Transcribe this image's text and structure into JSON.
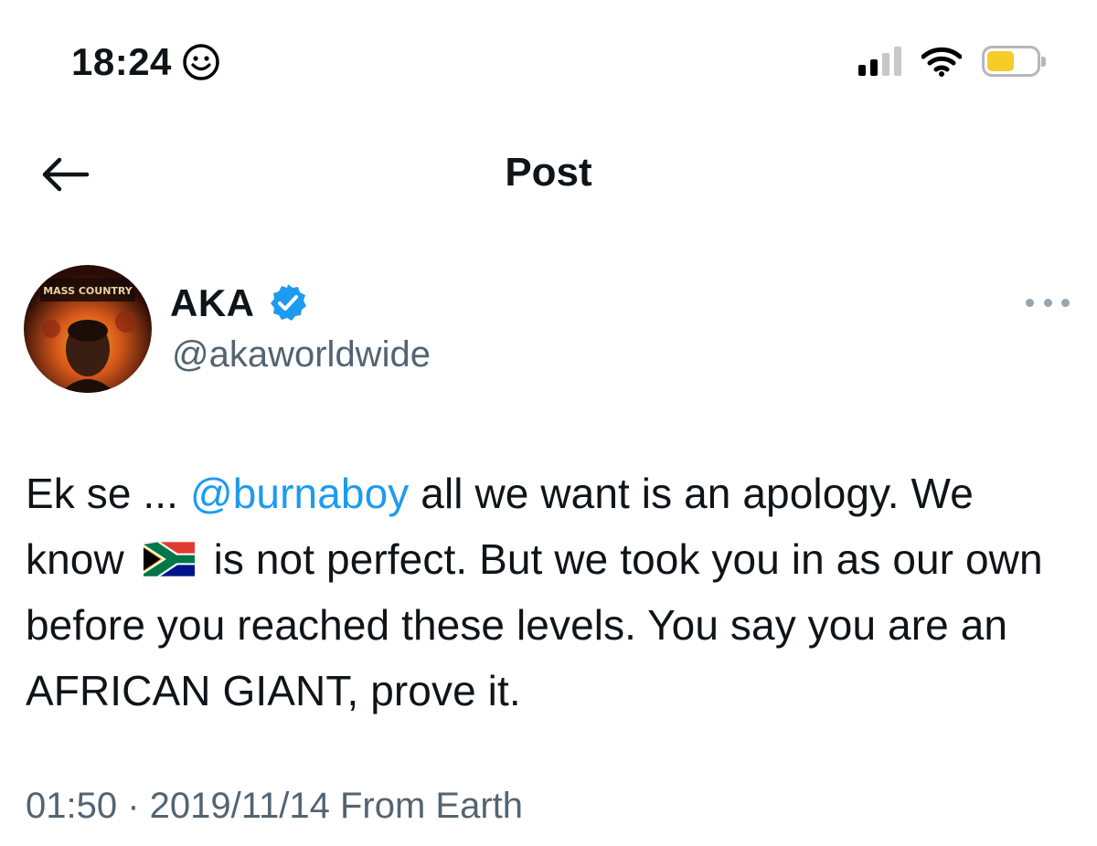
{
  "status_bar": {
    "time": "18:24",
    "smiley_icon": "smiley-face-icon",
    "signal_icon": "cellular-signal-icon",
    "wifi_icon": "wifi-icon",
    "battery_icon": "battery-icon",
    "battery_level": 0.55,
    "battery_color": "#f5cc28"
  },
  "header": {
    "back_icon": "arrow-left-icon",
    "title": "Post"
  },
  "author": {
    "name": "AKA",
    "handle": "@akaworldwide",
    "verified": true,
    "verified_color": "#1d9bf0",
    "avatar_text": "MASS COUNTRY",
    "more_icon": "more-horizontal-icon"
  },
  "tweet": {
    "prefix": "Ek se ... ",
    "mention": "@burnaboy",
    "part1": " all we want is an apology. We know",
    "flag": "south-africa-flag",
    "part2": "is not perfect. But we took you in as our own before you reached these levels. You say you are an AFRICAN GIANT, prove it."
  },
  "meta": {
    "timestamp": "01:50 · 2019/11/14 From Earth"
  },
  "colors": {
    "text": "#0f1419",
    "muted": "#536471",
    "link": "#1d9bf0",
    "background": "#ffffff"
  }
}
